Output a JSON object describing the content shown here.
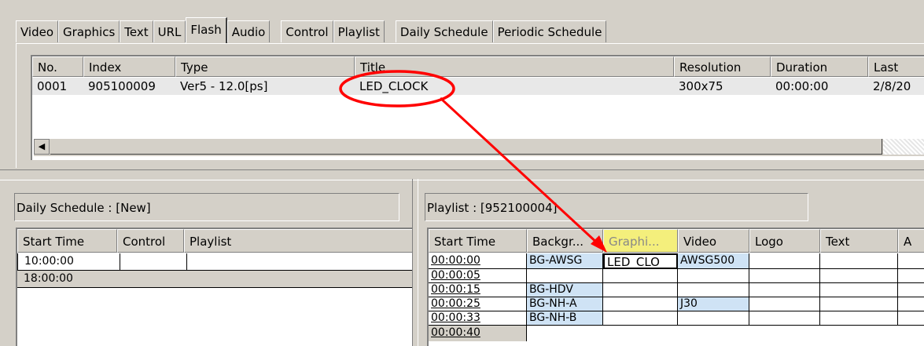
{
  "tabs": {
    "group1": [
      "Video",
      "Graphics",
      "Text",
      "URL",
      "Flash",
      "Audio"
    ],
    "group2": [
      "Control",
      "Playlist"
    ],
    "group3": [
      "Daily Schedule",
      "Periodic Schedule"
    ],
    "active": "Flash"
  },
  "flash_list": {
    "columns": [
      "No.",
      "Index",
      "Type",
      "Title",
      "Resolution",
      "Duration",
      "Last"
    ],
    "rows": [
      {
        "no": "0001",
        "index": "905100009",
        "type": "Ver5 - 12.0[ps]",
        "title": "LED_CLOCK",
        "resolution": "300x75",
        "duration": "00:00:00",
        "last": "2/8/20"
      }
    ],
    "scroll_left_icon": "scroll-left-arrow"
  },
  "daily_schedule": {
    "label": "Daily Schedule : [New]",
    "columns": [
      "Start Time",
      "Control",
      "Playlist"
    ],
    "rows": [
      "10:00:00",
      "18:00:00"
    ]
  },
  "playlist": {
    "label": "Playlist : [952100004]",
    "columns": [
      "Start Time",
      "Backgr...",
      "Graphi...",
      "Video",
      "Logo",
      "Text",
      "A"
    ],
    "rows": [
      {
        "time": "00:00:00",
        "bg": "BG-AWSG",
        "graphics": "LED_CLO",
        "video": "AWSG500"
      },
      {
        "time": "00:00:05",
        "bg": "",
        "graphics": "",
        "video": ""
      },
      {
        "time": "00:00:15",
        "bg": "BG-HDV",
        "graphics": "",
        "video": ""
      },
      {
        "time": "00:00:25",
        "bg": "BG-NH-A",
        "graphics": "",
        "video": "J30"
      },
      {
        "time": "00:00:33",
        "bg": "BG-NH-B",
        "graphics": "",
        "video": ""
      },
      {
        "time": "00:00:40",
        "bg": "",
        "graphics": "",
        "video": ""
      }
    ]
  },
  "annotation": {
    "color": "#ff0000",
    "highlight": "#ffff66"
  }
}
